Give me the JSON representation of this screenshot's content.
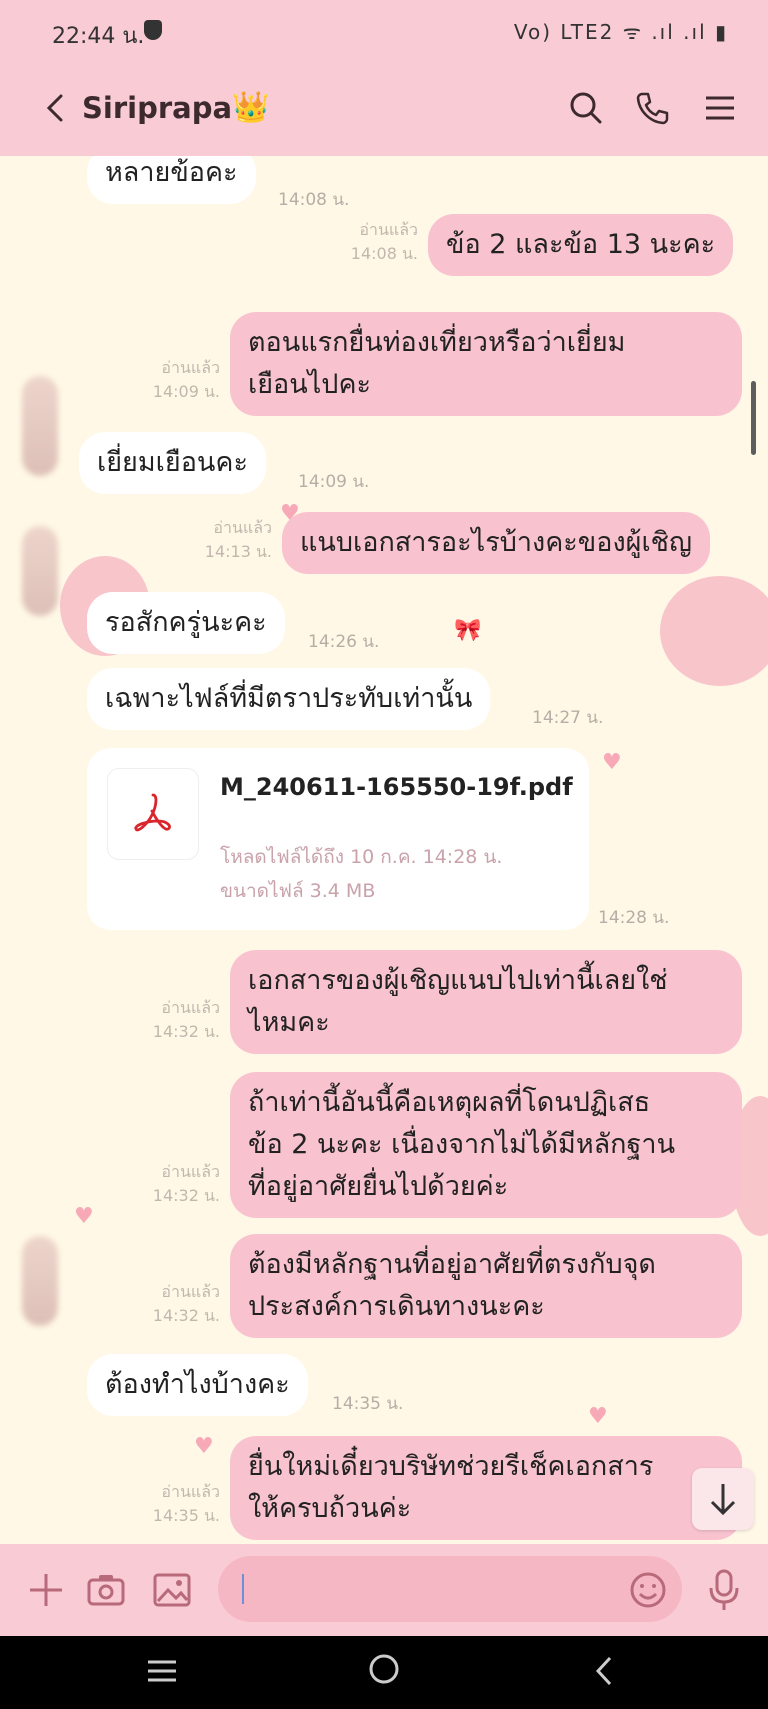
{
  "status": {
    "time": "22:44 น.",
    "icons": "Vo) LTE2 ᯤ .ıl .ıl ▮"
  },
  "header": {
    "title": "Siriprapa",
    "crown": "👑"
  },
  "messages": {
    "m1": {
      "text": "หลายข้อคะ",
      "time": "14:08 น."
    },
    "m2": {
      "text": "ข้อ 2 และข้อ 13 นะคะ",
      "read": "อ่านแล้ว",
      "time": "14:08 น."
    },
    "m3": {
      "line1": "ตอนแรกยื่นท่องเที่ยวหรือว่าเยี่ยม",
      "line2": "เยือนไปคะ",
      "read": "อ่านแล้ว",
      "time": "14:09 น."
    },
    "m4": {
      "text": "เยี่ยมเยือนคะ",
      "time": "14:09 น."
    },
    "m5": {
      "text": "แนบเอกสารอะไรบ้างคะของผู้เชิญ",
      "read": "อ่านแล้ว",
      "time": "14:13 น."
    },
    "m6": {
      "text": "รอสักครู่นะคะ",
      "time": "14:26 น."
    },
    "m7": {
      "text": "เฉพาะไฟล์ที่มีตราประทับเท่านั้น",
      "time": "14:27 น."
    },
    "file": {
      "name": "M_240611-165550-19f.pdf",
      "downloaded": "โหลดไฟล์ได้ถึง 10 ก.ค. 14:28 น.",
      "size": "ขนาดไฟล์ 3.4 MB",
      "time": "14:28 น."
    },
    "m8": {
      "line1": "เอกสารของผู้เชิญแนบไปเท่านี้เลยใช่",
      "line2": "ไหมคะ",
      "read": "อ่านแล้ว",
      "time": "14:32 น."
    },
    "m9": {
      "line1": "ถ้าเท่านี้อันนี้คือเหตุผลที่โดนปฏิเสธ",
      "line2": "ข้อ 2 นะคะ  เนื่องจากไม่ได้มีหลักฐาน",
      "line3": "ที่อยู่อาศัยยื่นไปด้วยค่ะ",
      "read": "อ่านแล้ว",
      "time": "14:32 น."
    },
    "m10": {
      "line1": "ต้องมีหลักฐานที่อยู่อาศัยที่ตรงกับจุด",
      "line2": "ประสงค์การเดินทางนะคะ",
      "read": "อ่านแล้ว",
      "time": "14:32 น."
    },
    "m11": {
      "text": "ต้องทำไงบ้างคะ",
      "time": "14:35 น."
    },
    "m12": {
      "line1": "ยื่นใหม่เดี๋ยวบริษัทช่วยรีเช็คเอกสาร",
      "line2": "ให้ครบถ้วนค่ะ",
      "read": "อ่านแล้ว",
      "time": "14:35 น."
    }
  },
  "input": {
    "value": ""
  },
  "colors": {
    "accent": "#f8cbd5",
    "bubble_out": "#f8c3cf",
    "background": "#fff8e6"
  }
}
